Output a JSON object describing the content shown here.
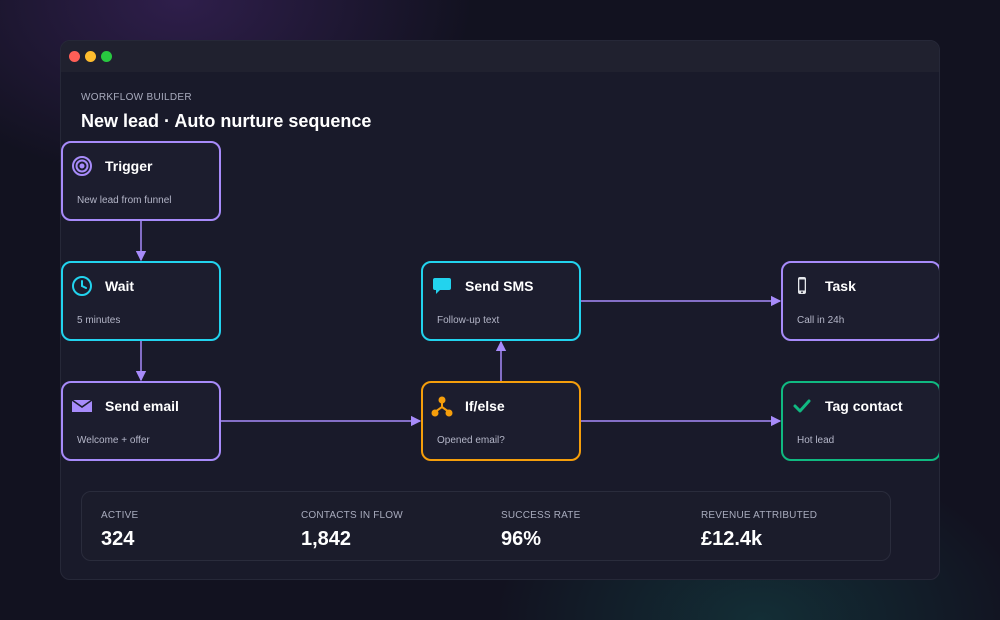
{
  "header": {
    "eyebrow": "WORKFLOW BUILDER",
    "title": "New lead · Auto nurture sequence"
  },
  "colors": {
    "purple": "#a78bfa",
    "cyan": "#22d3ee",
    "orange": "#f59e0b",
    "green": "#10b981"
  },
  "nodes": {
    "trigger": {
      "title": "Trigger",
      "subtitle": "New lead from funnel",
      "icon": "target-icon"
    },
    "wait": {
      "title": "Wait",
      "subtitle": "5 minutes",
      "icon": "clock-icon"
    },
    "send_email": {
      "title": "Send email",
      "subtitle": "Welcome + offer",
      "icon": "envelope-icon"
    },
    "if_else": {
      "title": "If/else",
      "subtitle": "Opened email?",
      "icon": "branch-icon"
    },
    "send_sms": {
      "title": "Send SMS",
      "subtitle": "Follow-up text",
      "icon": "chat-bubble-icon"
    },
    "task": {
      "title": "Task",
      "subtitle": "Call in 24h",
      "icon": "phone-icon"
    },
    "tag_contact": {
      "title": "Tag contact",
      "subtitle": "Hot lead",
      "icon": "checkmark-icon"
    }
  },
  "stats": [
    {
      "label": "ACTIVE",
      "value": "324"
    },
    {
      "label": "CONTACTS IN FLOW",
      "value": "1,842"
    },
    {
      "label": "SUCCESS RATE",
      "value": "96%"
    },
    {
      "label": "REVENUE ATTRIBUTED",
      "value": "£12.4k"
    }
  ]
}
